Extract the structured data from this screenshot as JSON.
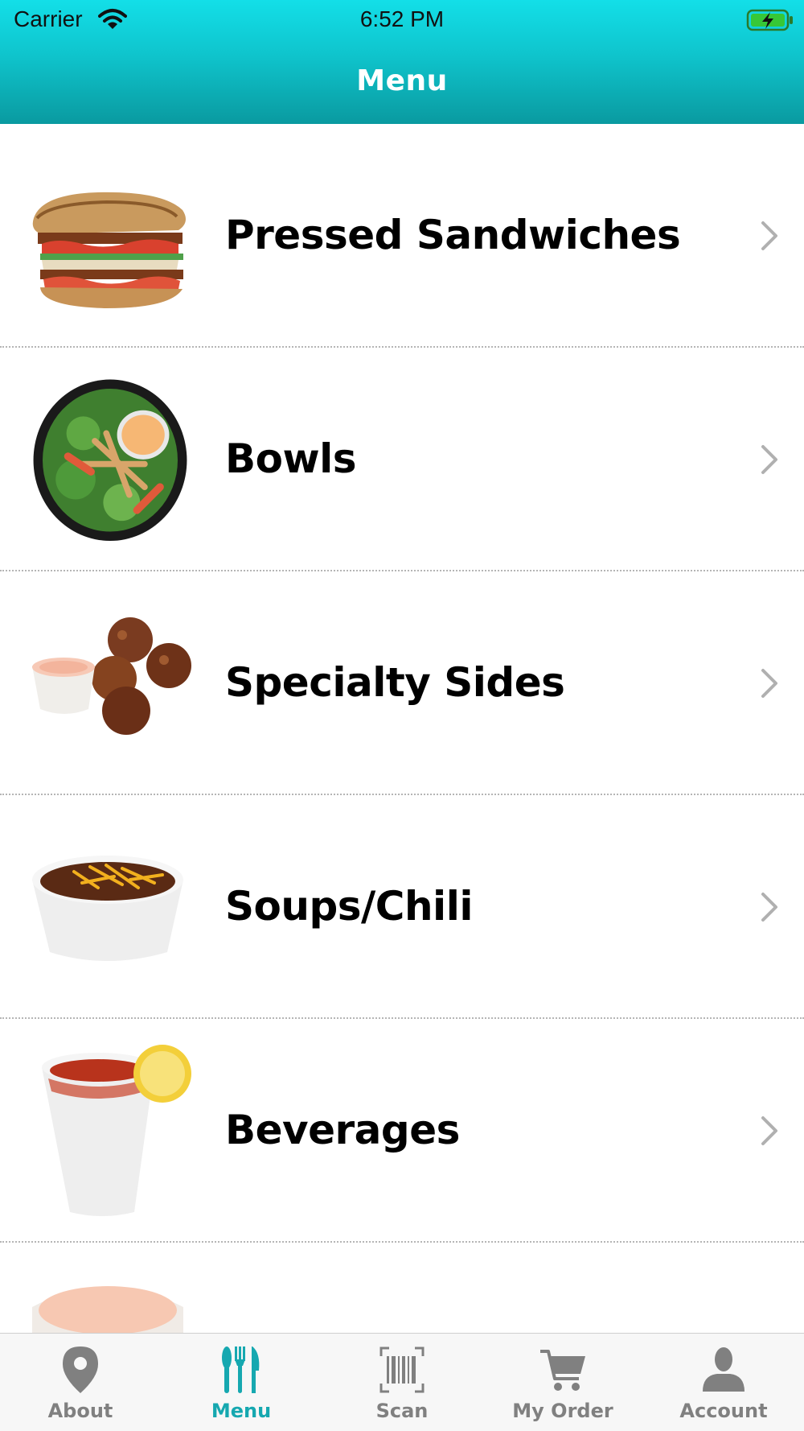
{
  "status_bar": {
    "carrier": "Carrier",
    "time": "6:52 PM"
  },
  "header": {
    "title": "Menu"
  },
  "menu": {
    "items": [
      {
        "label": "Pressed Sandwiches",
        "icon": "sandwich-image"
      },
      {
        "label": "Bowls",
        "icon": "salad-bowl-image"
      },
      {
        "label": "Specialty Sides",
        "icon": "fritters-image"
      },
      {
        "label": "Soups/Chili",
        "icon": "chili-cup-image"
      },
      {
        "label": "Beverages",
        "icon": "iced-tea-image"
      },
      {
        "label": "",
        "icon": "sauce-cup-image"
      }
    ]
  },
  "tabbar": {
    "items": [
      {
        "label": "About",
        "icon": "map-pin-icon"
      },
      {
        "label": "Menu",
        "icon": "fork-knife-icon",
        "active": true
      },
      {
        "label": "Scan",
        "icon": "barcode-icon"
      },
      {
        "label": "My Order",
        "icon": "cart-icon"
      },
      {
        "label": "Account",
        "icon": "person-icon"
      }
    ]
  },
  "colors": {
    "header_top": "#13dfe8",
    "header_bottom": "#0a9aa0",
    "tab_active": "#16a8b0",
    "tab_inactive": "#808080"
  }
}
